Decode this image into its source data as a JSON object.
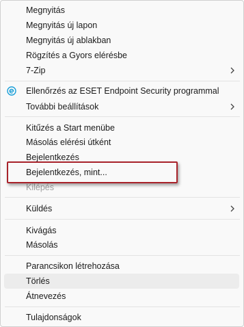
{
  "menu": {
    "groups": [
      {
        "items": [
          {
            "label": "Megnyitás"
          },
          {
            "label": "Megnyitás új lapon"
          },
          {
            "label": "Megnyitás új ablakban"
          },
          {
            "label": "Rögzítés a Gyors elérésbe"
          },
          {
            "label": "7-Zip",
            "submenu": true
          }
        ]
      },
      {
        "items": [
          {
            "label": "Ellenőrzés az ESET Endpoint Security programmal",
            "icon": "eset-icon"
          },
          {
            "label": "További beállítások",
            "submenu": true
          }
        ]
      },
      {
        "items": [
          {
            "label": "Kitűzés a Start menübe"
          },
          {
            "label": "Másolás elérési útként"
          },
          {
            "label": "Bejelentkezés"
          },
          {
            "label": "Bejelentkezés, mint...",
            "highlighted_by_callout": true
          },
          {
            "label": "Kilépés",
            "disabled": true
          }
        ]
      },
      {
        "items": [
          {
            "label": "Küldés",
            "submenu": true
          }
        ]
      },
      {
        "items": [
          {
            "label": "Kivágás"
          },
          {
            "label": "Másolás"
          }
        ]
      },
      {
        "items": [
          {
            "label": "Parancsikon létrehozása"
          },
          {
            "label": "Törlés",
            "hovered": true
          },
          {
            "label": "Átnevezés"
          }
        ]
      },
      {
        "items": [
          {
            "label": "Tulajdonságok"
          }
        ]
      }
    ]
  },
  "colors": {
    "callout_border": "#a8222a",
    "eset_icon": "#1a9fd8"
  }
}
